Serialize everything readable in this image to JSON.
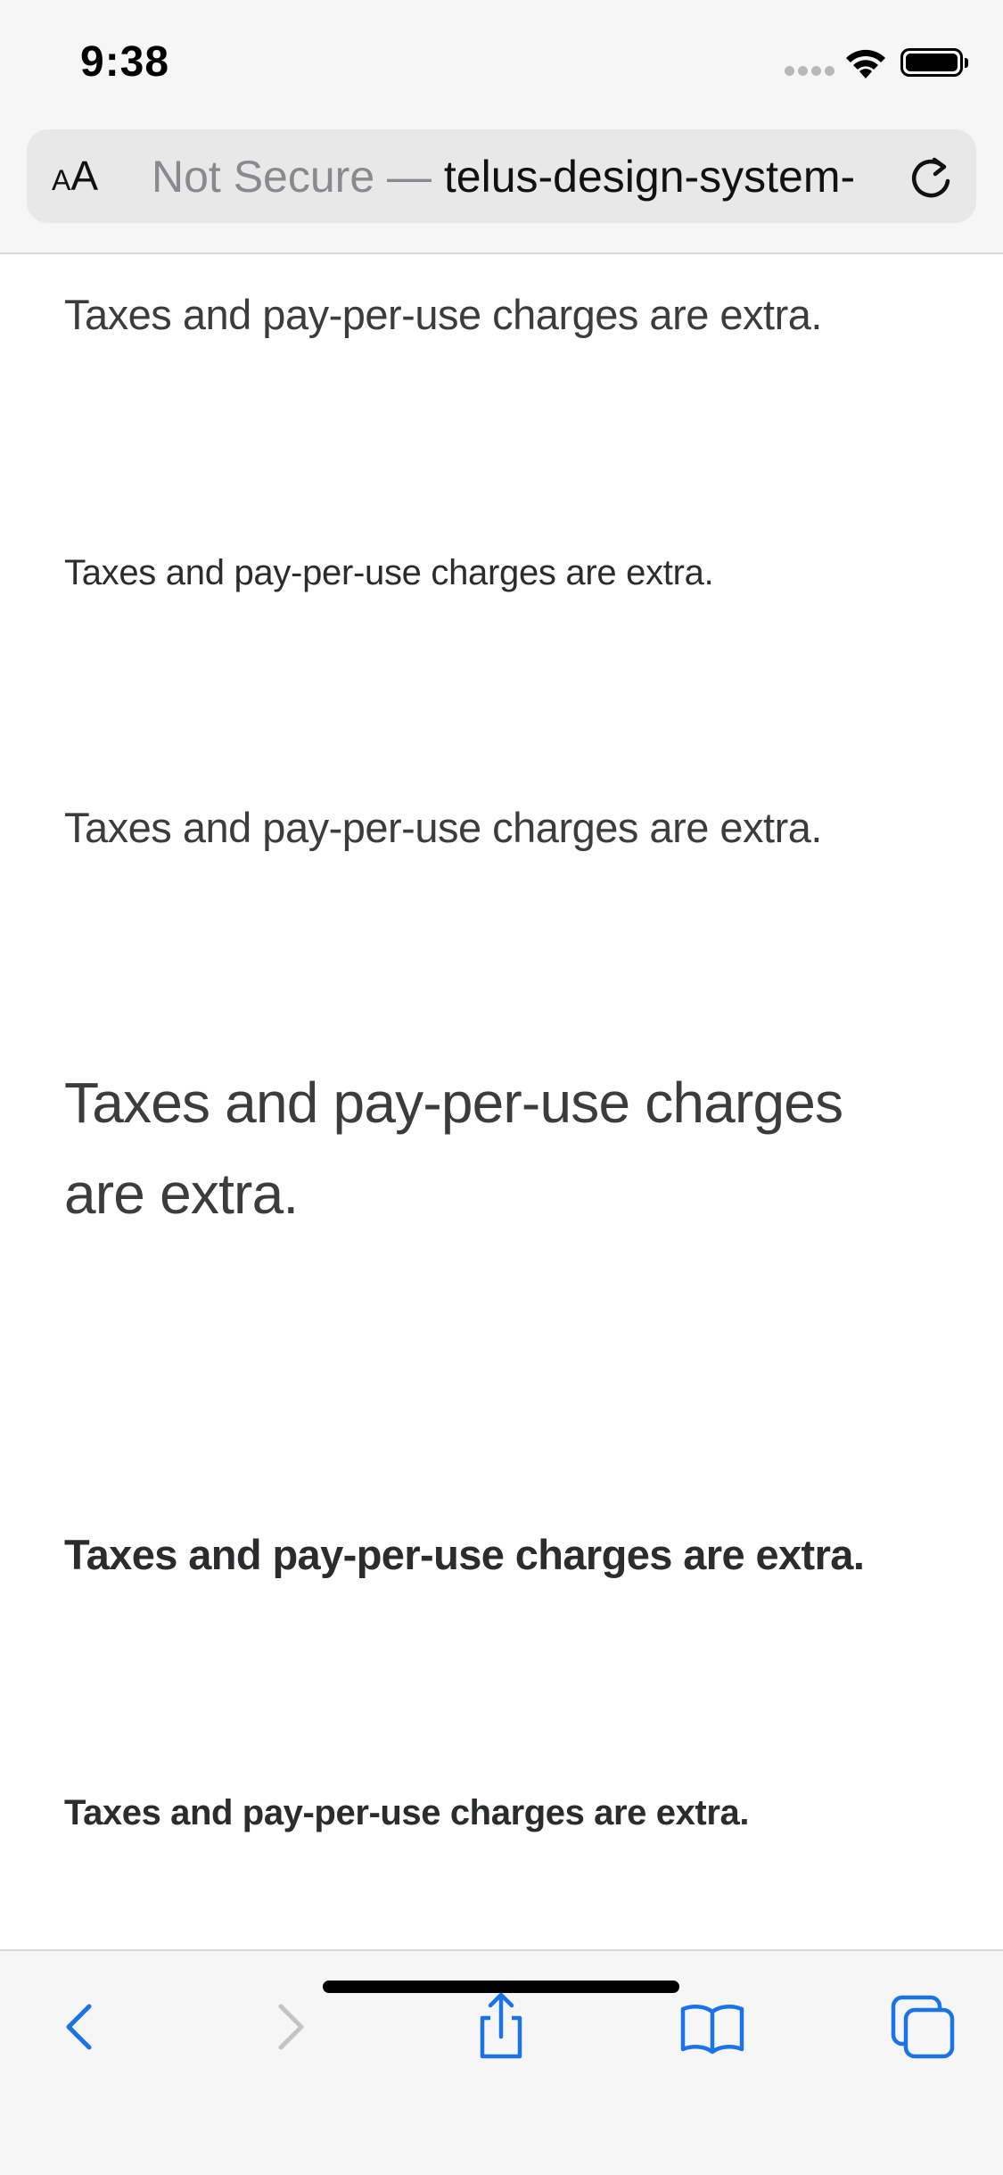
{
  "status_bar": {
    "time": "9:38"
  },
  "address_bar": {
    "text_size_label_small": "A",
    "text_size_label_large": "A",
    "security_prefix": "Not Secure — ",
    "domain": "telus-design-system-"
  },
  "content": {
    "samples": [
      "Taxes and pay-per-use charges are extra.",
      "Taxes and pay-per-use charges are extra.",
      "Taxes and pay-per-use charges are extra.",
      "Taxes and pay-per-use charges are extra.",
      "Taxes and pay-per-use charges are extra.",
      "Taxes and pay-per-use charges are extra."
    ]
  },
  "toolbar": {
    "icons": [
      "back-icon",
      "forward-icon",
      "share-icon",
      "bookmarks-icon",
      "tabs-icon"
    ],
    "accent_color": "#1a73e8",
    "disabled_color": "#c4c4c6"
  }
}
